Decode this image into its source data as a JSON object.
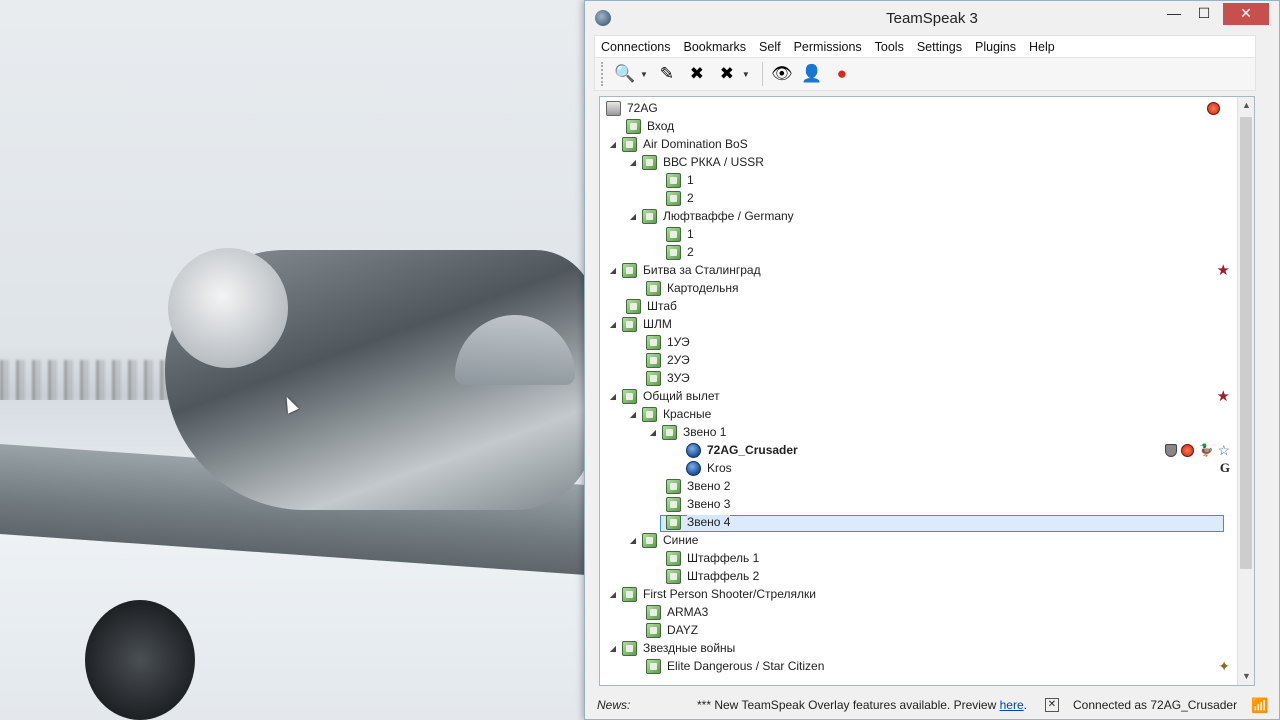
{
  "window": {
    "title": "TeamSpeak 3",
    "min_label": "—",
    "max_label": "☐",
    "close_label": "✕"
  },
  "menu": [
    "Connections",
    "Bookmarks",
    "Self",
    "Permissions",
    "Tools",
    "Settings",
    "Plugins",
    "Help"
  ],
  "toolbar": {
    "icons": [
      "connect-icon",
      "disconnect-icon",
      "mute-mic-icon",
      "mute-speakers-icon",
      "away-icon",
      "subscribe-icon",
      "contacts-icon",
      "record-icon"
    ]
  },
  "tree": {
    "server": "72AG",
    "rows": [
      {
        "label": "Вход"
      },
      {
        "label": "Air Domination BoS"
      },
      {
        "label": "ВВС РККА / USSR"
      },
      {
        "label": "1"
      },
      {
        "label": "2"
      },
      {
        "label": "Люфтваффе / Germany"
      },
      {
        "label": "1"
      },
      {
        "label": "2"
      },
      {
        "label": "Битва за Сталинград"
      },
      {
        "label": "Картодельня"
      },
      {
        "label": "Штаб"
      },
      {
        "label": "ШЛМ"
      },
      {
        "label": "1УЭ"
      },
      {
        "label": "2УЭ"
      },
      {
        "label": "3УЭ"
      },
      {
        "label": "Общий вылет"
      },
      {
        "label": "Красные"
      },
      {
        "label": "Звено 1"
      },
      {
        "label": "72AG_Crusader"
      },
      {
        "label": "Kros"
      },
      {
        "label": "Звено 2"
      },
      {
        "label": "Звено 3"
      },
      {
        "label": "Звено 4"
      },
      {
        "label": "Синие"
      },
      {
        "label": "Штаффель 1"
      },
      {
        "label": "Штаффель 2"
      },
      {
        "label": "First Person Shooter/Стрелялки"
      },
      {
        "label": "ARMA3"
      },
      {
        "label": "DAYZ"
      },
      {
        "label": "Звездные войны"
      },
      {
        "label": "Elite Dangerous / Star Citizen"
      }
    ]
  },
  "status": {
    "news_label": "News:",
    "news_text": "*** New TeamSpeak Overlay features available. Preview ",
    "news_link": "here",
    "news_tail": ".",
    "news_close": "✕",
    "connected": "Connected as 72AG_Crusader"
  },
  "badges": {
    "star": "★",
    "star_outline": "☆",
    "house": "⌂",
    "duck": "🦆",
    "g": "G",
    "wings": "✦"
  },
  "colors": {
    "accent": "#4a8ad2",
    "close_button": "#c7504e",
    "channel_green": "#5e9b4d",
    "star_red": "#a11d2a"
  }
}
